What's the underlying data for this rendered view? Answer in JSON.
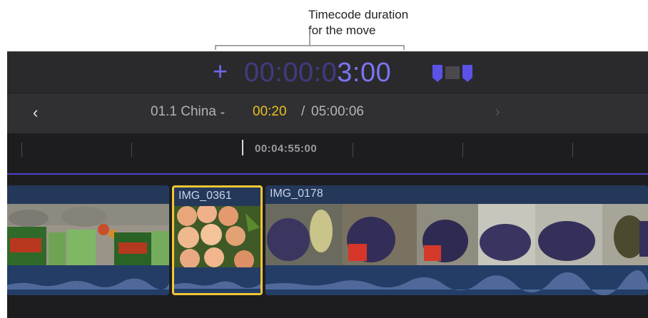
{
  "callout": {
    "line1": "Timecode duration",
    "line2": "for the move"
  },
  "timecode_entry": {
    "operator": "+",
    "dim_digits": "00:00:0",
    "bright_digits": "3:00",
    "move_icon": "move-clip-icon"
  },
  "navigation": {
    "back_icon": "chevron-left-icon",
    "back_glyph": "‹",
    "project_name": "01.1 China",
    "project_chevron": "⌄",
    "current_time": "00:20",
    "separator": "/",
    "total_time": "05:00:06",
    "forward_icon": "chevron-right-icon",
    "forward_glyph": "›"
  },
  "ruler": {
    "timecode": "00:04:55:00"
  },
  "timeline": {
    "clips": [
      {
        "title": "",
        "selected": false
      },
      {
        "title": "IMG_0361",
        "selected": true
      },
      {
        "title": "IMG_0178",
        "selected": false
      }
    ]
  },
  "colors": {
    "accent_purple": "#7b74f2",
    "playhead_time_yellow": "#e8c021",
    "selection_yellow": "#f2c737",
    "clip_blue": "#24385a"
  }
}
